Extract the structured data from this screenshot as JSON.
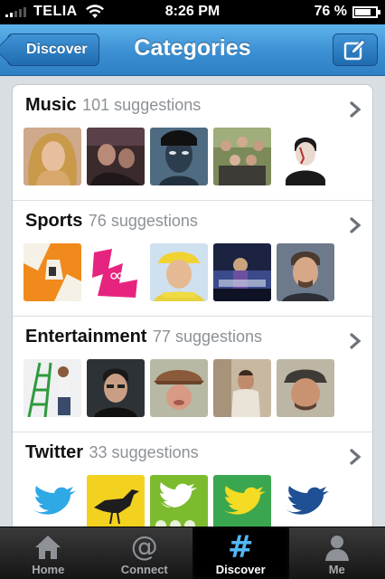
{
  "status_bar": {
    "carrier": "TELIA",
    "time": "8:26 PM",
    "battery": "76 %",
    "battery_level": 0.76,
    "signal_bars": 2
  },
  "nav": {
    "title": "Categories",
    "back_label": "Discover",
    "compose_icon": "compose-icon"
  },
  "categories": [
    {
      "name": "Music",
      "count": "101 suggestions"
    },
    {
      "name": "Sports",
      "count": "76 suggestions"
    },
    {
      "name": "Entertainment",
      "count": "77 suggestions"
    },
    {
      "name": "Twitter",
      "count": "33 suggestions"
    }
  ],
  "tabs": [
    {
      "label": "Home",
      "icon": "home-icon",
      "active": false
    },
    {
      "label": "Connect",
      "icon": "at-icon",
      "active": false
    },
    {
      "label": "Discover",
      "icon": "hash-icon",
      "active": true
    },
    {
      "label": "Me",
      "icon": "person-icon",
      "active": false
    }
  ],
  "colors": {
    "nav_blue": "#3b8fd3",
    "accent": "#53b7f4",
    "twitter_blue": "#2fa8e6"
  }
}
